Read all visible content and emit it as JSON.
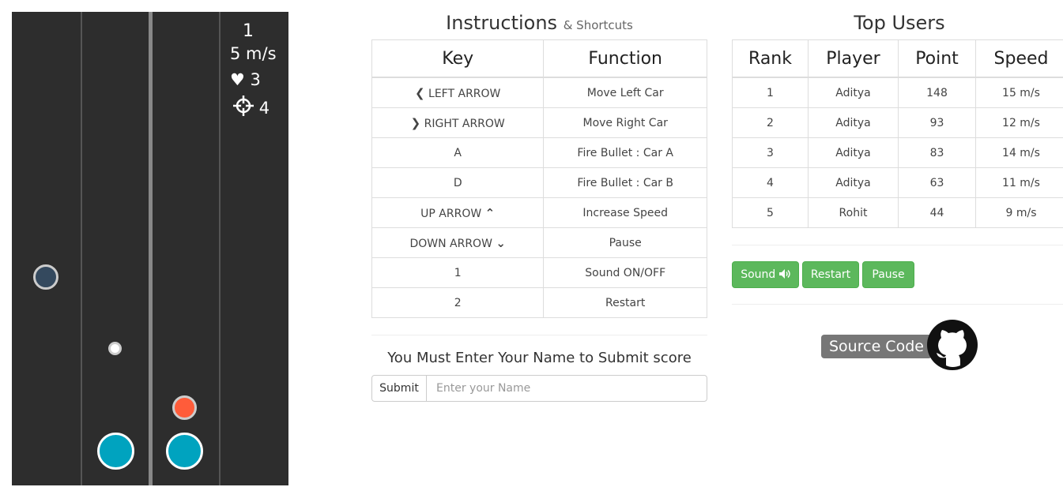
{
  "hud": {
    "score": "1",
    "speed": "5 m/s",
    "lives": "3",
    "bullets": "4",
    "heart_icon": "heart-icon",
    "crosshair_icon": "crosshair-icon"
  },
  "instructions": {
    "title": "Instructions",
    "subtitle": "& Shortcuts",
    "headers": {
      "key": "Key",
      "function": "Function"
    },
    "rows": [
      {
        "key": "LEFT ARROW",
        "function": "Move Left Car",
        "icon": "chevron-left-icon"
      },
      {
        "key": "RIGHT ARROW",
        "function": "Move Right Car",
        "icon": "chevron-right-icon"
      },
      {
        "key": "A",
        "function": "Fire Bullet : Car A"
      },
      {
        "key": "D",
        "function": "Fire Bullet : Car B"
      },
      {
        "key": "UP ARROW",
        "function": "Increase Speed",
        "icon": "chevron-up-icon"
      },
      {
        "key": "DOWN ARROW",
        "function": "Pause",
        "icon": "chevron-down-icon"
      },
      {
        "key": "1",
        "function": "Sound ON/OFF"
      },
      {
        "key": "2",
        "function": "Restart"
      }
    ]
  },
  "submit": {
    "prompt": "You Must Enter Your Name to Submit score",
    "button_label": "Submit",
    "placeholder": "Enter your Name",
    "value": ""
  },
  "top_users": {
    "title": "Top Users",
    "headers": {
      "rank": "Rank",
      "player": "Player",
      "point": "Point",
      "speed": "Speed"
    },
    "rows": [
      {
        "rank": "1",
        "player": "Aditya",
        "point": "148",
        "speed": "15 m/s"
      },
      {
        "rank": "2",
        "player": "Aditya",
        "point": "93",
        "speed": "12 m/s"
      },
      {
        "rank": "3",
        "player": "Aditya",
        "point": "83",
        "speed": "14 m/s"
      },
      {
        "rank": "4",
        "player": "Aditya",
        "point": "63",
        "speed": "11 m/s"
      },
      {
        "rank": "5",
        "player": "Rohit",
        "point": "44",
        "speed": "9 m/s"
      }
    ]
  },
  "controls": {
    "sound_label": "Sound",
    "sound_icon": "speaker-icon",
    "restart_label": "Restart",
    "pause_label": "Pause"
  },
  "source": {
    "label": "Source Code",
    "icon": "github-icon"
  },
  "colors": {
    "board": "#2d2d2d",
    "car": "#00a3bf",
    "bomb": "#ff5c3a",
    "obstacle_dark": "#34495e",
    "bullet": "#ffffff",
    "button_green": "#5cb85c"
  }
}
